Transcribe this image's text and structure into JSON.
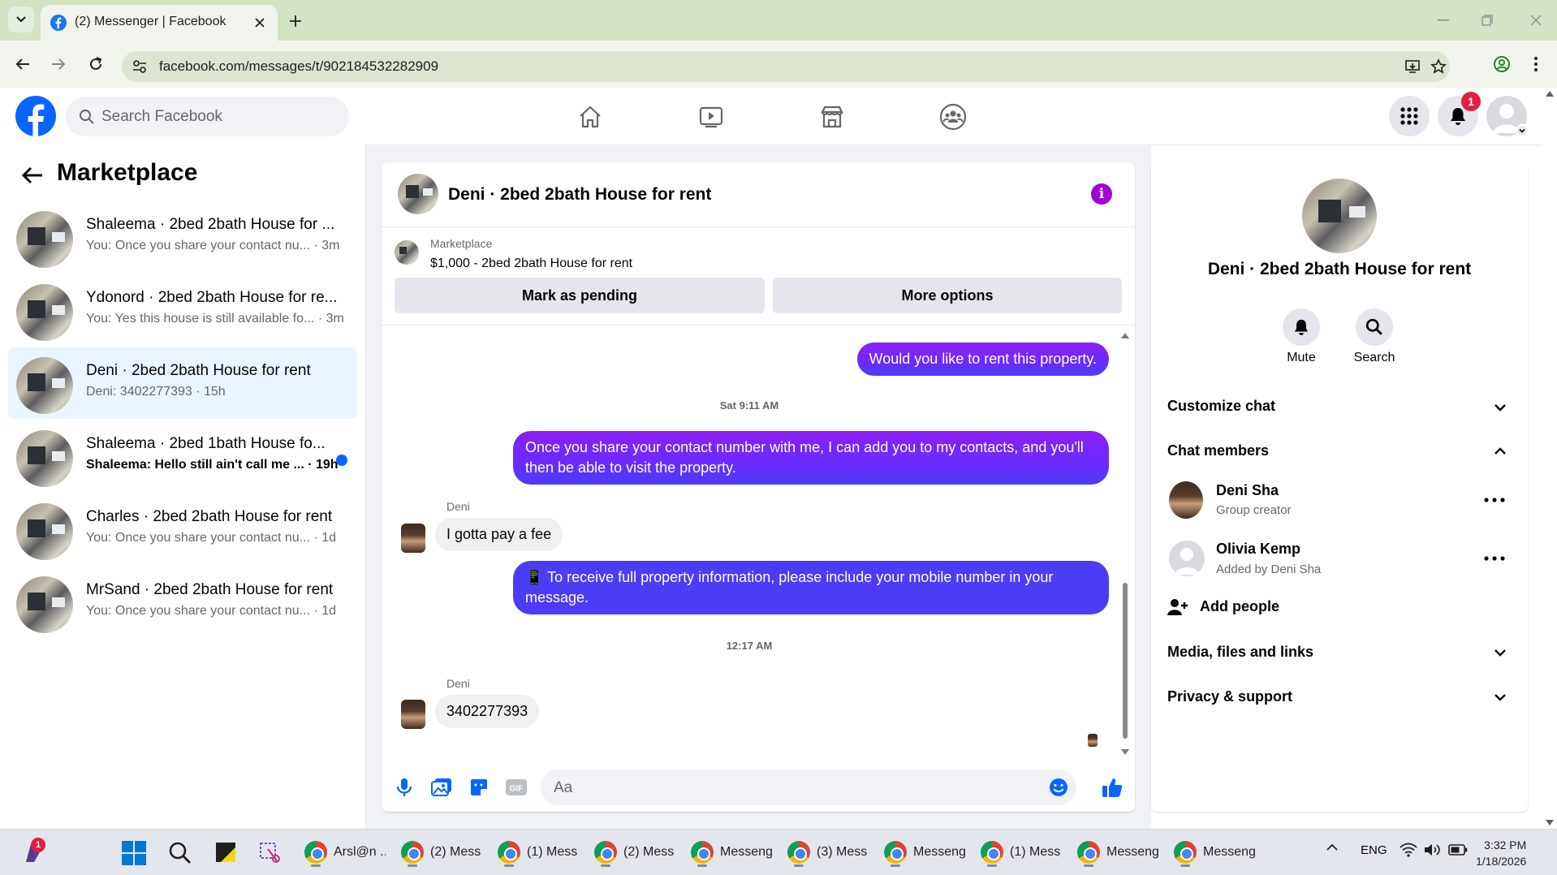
{
  "browser": {
    "tab_title": "(2) Messenger | Facebook",
    "url": "facebook.com/messages/t/902184532282909"
  },
  "fb": {
    "search_placeholder": "Search Facebook",
    "notification_count": "1"
  },
  "left": {
    "title": "Marketplace",
    "threads": [
      {
        "title": "Shaleema · 2bed 2bath House for ...",
        "preview": "You: Once you share your contact nu... · 3m",
        "unread": false,
        "active": false
      },
      {
        "title": "Ydonord · 2bed 2bath House for re...",
        "preview": "You: Yes this house is still available fo... · 3m",
        "unread": false,
        "active": false
      },
      {
        "title": "Deni · 2bed 2bath House for rent",
        "preview": "Deni: 3402277393 · 15h",
        "unread": false,
        "active": true
      },
      {
        "title": "Shaleema · 2bed 1bath House fo...",
        "preview": "Shaleema: Hello still ain't call me ... · 19h",
        "unread": true,
        "active": false
      },
      {
        "title": "Charles · 2bed 2bath House for rent",
        "preview": "You: Once you share your contact nu... · 1d",
        "unread": false,
        "active": false
      },
      {
        "title": "MrSand · 2bed 2bath House for rent",
        "preview": "You: Once you share your contact nu... · 1d",
        "unread": false,
        "active": false
      }
    ]
  },
  "chat": {
    "title": "Deni · 2bed 2bath House for rent",
    "marketplace_label": "Marketplace",
    "listing": "$1,000 - 2bed 2bath House for rent",
    "btn_pending": "Mark as pending",
    "btn_more": "More options",
    "msg1": "Would you like to rent this property.",
    "time1": "Sat 9:11 AM",
    "msg2": "Once you share your contact number with me, I can add you to my contacts, and you'll then be able to visit the property.",
    "sender1": "Deni",
    "msg3": "I gotta pay a fee",
    "msg4": "📱 To receive full property information, please include your mobile number in your message.",
    "time2": "12:17 AM",
    "sender2": "Deni",
    "msg5": "3402277393",
    "input_placeholder": "Aa"
  },
  "right": {
    "title": "Deni · 2bed 2bath House for rent",
    "mute": "Mute",
    "search": "Search",
    "customize": "Customize chat",
    "members_header": "Chat members",
    "members": [
      {
        "name": "Deni Sha",
        "role": "Group creator"
      },
      {
        "name": "Olivia Kemp",
        "role": "Added by Deni Sha"
      }
    ],
    "add_people": "Add people",
    "media": "Media, files and links",
    "privacy": "Privacy & support"
  },
  "taskbar": {
    "badge": "1",
    "apps": [
      "Arsl@n ...",
      "(2) Mess",
      "(1) Mess",
      "(2) Mess",
      "Messeng",
      "(3) Mess",
      "Messeng",
      "(1) Mess",
      "Messeng",
      "Messeng"
    ],
    "lang": "ENG",
    "time": "3:32 PM",
    "date": "1/18/2026"
  },
  "colors": {
    "accent": "#0866ff",
    "outgoing": "#7a1ff5",
    "info": "#a200d3"
  }
}
